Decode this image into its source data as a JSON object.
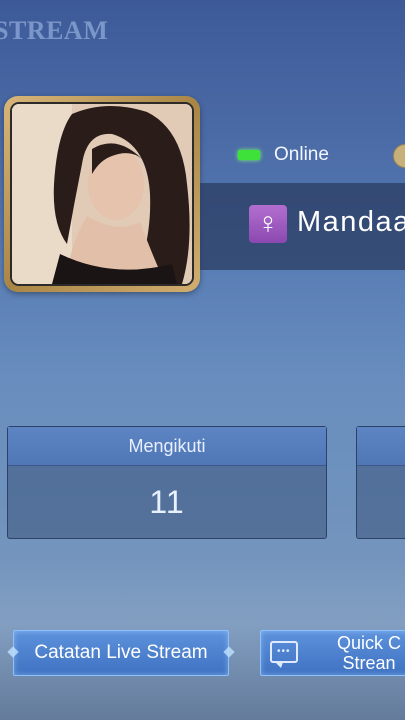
{
  "header": {
    "title": "STREAM"
  },
  "profile": {
    "status_label": "Online",
    "username": "Mandaa",
    "gender_symbol": "♀",
    "avatar_desc": "profile photo"
  },
  "stats": [
    {
      "label": "Mengikuti",
      "value": "11"
    },
    {
      "label": "",
      "value": ""
    }
  ],
  "buttons": {
    "live_history": "Catatan Live Stream",
    "quick_line1": "Quick C",
    "quick_line2": "Strean"
  },
  "colors": {
    "online": "#3ee03a",
    "gender_badge": "#9d5ac0",
    "button": "#4a7fcf",
    "frame_gold": "#c9a562"
  }
}
